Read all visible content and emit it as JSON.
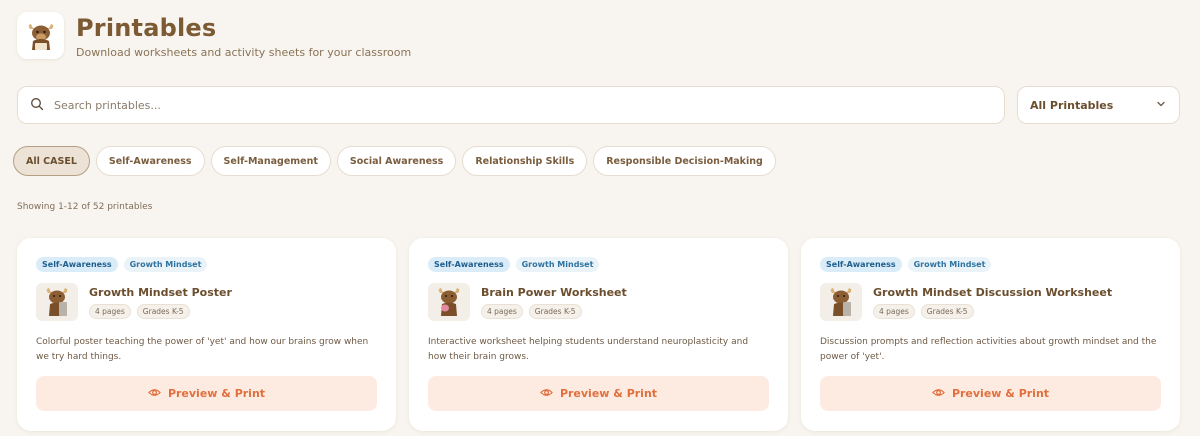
{
  "header": {
    "title": "Printables",
    "subtitle": "Download worksheets and activity sheets for your classroom",
    "logo_icon": "yak-mascot-icon"
  },
  "search": {
    "placeholder": "Search printables...",
    "value": ""
  },
  "filter": {
    "selected": "All Printables"
  },
  "categories": [
    {
      "label": "All CASEL",
      "active": true
    },
    {
      "label": "Self-Awareness",
      "active": false
    },
    {
      "label": "Self-Management",
      "active": false
    },
    {
      "label": "Social Awareness",
      "active": false
    },
    {
      "label": "Relationship Skills",
      "active": false
    },
    {
      "label": "Responsible Decision-Making",
      "active": false
    }
  ],
  "results": {
    "showing_text": "Showing 1-12 of 52 printables"
  },
  "cards": [
    {
      "tags": [
        "Self-Awareness",
        "Growth Mindset"
      ],
      "title": "Growth Mindset Poster",
      "pages": "4 pages",
      "grades": "Grades K-5",
      "description": "Colorful poster teaching the power of 'yet' and how our brains grow when we try hard things.",
      "button_label": "Preview & Print"
    },
    {
      "tags": [
        "Self-Awareness",
        "Growth Mindset"
      ],
      "title": "Brain Power Worksheet",
      "pages": "4 pages",
      "grades": "Grades K-5",
      "description": "Interactive worksheet helping students understand neuroplasticity and how their brain grows.",
      "button_label": "Preview & Print"
    },
    {
      "tags": [
        "Self-Awareness",
        "Growth Mindset"
      ],
      "title": "Growth Mindset Discussion Worksheet",
      "pages": "4 pages",
      "grades": "Grades K-5",
      "description": "Discussion prompts and reflection activities about growth mindset and the power of 'yet'.",
      "button_label": "Preview & Print"
    }
  ],
  "colors": {
    "background": "#f8f5f0",
    "title_brown": "#7b5a34",
    "accent_orange": "#e0703e",
    "button_bg": "#fdebe1",
    "tag_blue": "#2f74a0"
  }
}
